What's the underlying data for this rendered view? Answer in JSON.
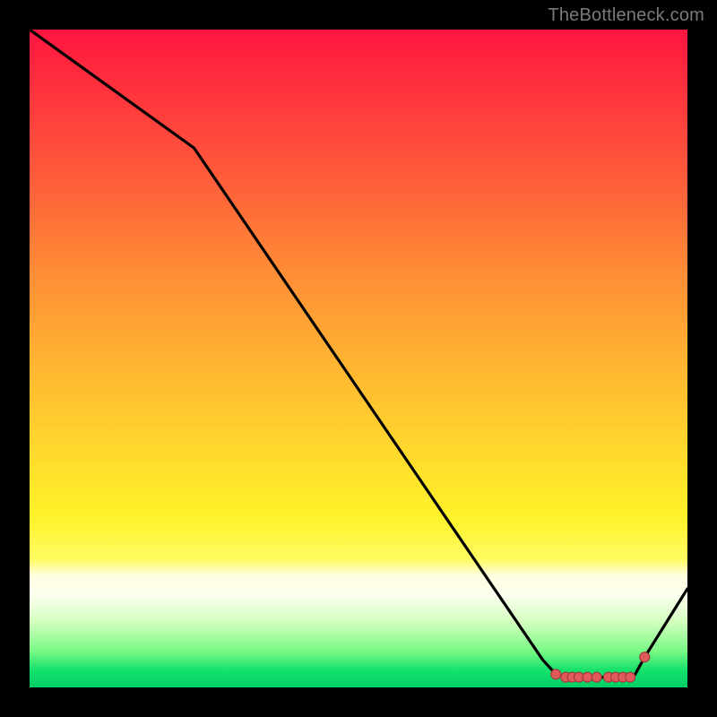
{
  "watermark": "TheBottleneck.com",
  "chart_data": {
    "type": "line",
    "title": "",
    "xlabel": "",
    "ylabel": "",
    "xlim": [
      0,
      100
    ],
    "ylim": [
      0,
      100
    ],
    "x": [
      0,
      25,
      78,
      80,
      81.5,
      82.5,
      83.5,
      84.8,
      86.2,
      88,
      89.1,
      90.2,
      91.3,
      92,
      93.5,
      100
    ],
    "y": [
      100,
      82,
      4.2,
      2,
      1.55,
      1.55,
      1.55,
      1.55,
      1.55,
      1.55,
      1.55,
      1.55,
      1.55,
      1.9,
      4.6,
      15
    ],
    "markers_x": [
      80,
      81.5,
      82.5,
      83.5,
      84.8,
      86.2,
      88,
      89.1,
      90.2,
      91.3,
      93.5
    ],
    "markers_y": [
      2,
      1.55,
      1.55,
      1.55,
      1.55,
      1.55,
      1.55,
      1.55,
      1.55,
      1.55,
      4.6
    ],
    "colors": {
      "line": "#000000",
      "marker_fill": "#e05a5a",
      "marker_stroke": "#a43b3b"
    }
  }
}
